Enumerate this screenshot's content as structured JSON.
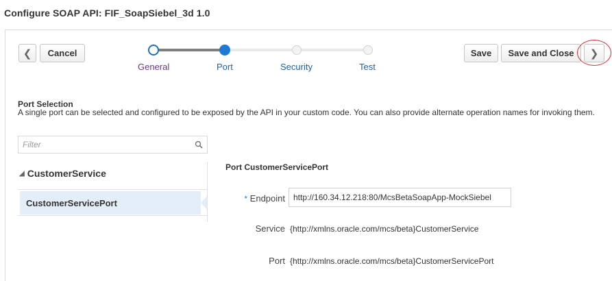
{
  "page": {
    "title": "Configure SOAP API: FIF_SoapSiebel_3d 1.0"
  },
  "toolbar": {
    "back_icon": "chevron-left-icon",
    "cancel_label": "Cancel",
    "save_label": "Save",
    "save_close_label": "Save and Close",
    "next_icon": "chevron-right-icon"
  },
  "train": {
    "steps": [
      {
        "label": "General",
        "state": "visited"
      },
      {
        "label": "Port",
        "state": "current"
      },
      {
        "label": "Security",
        "state": "unvisited"
      },
      {
        "label": "Test",
        "state": "unvisited"
      }
    ]
  },
  "section": {
    "title": "Port Selection",
    "description": "A single port can be selected and configured to be exposed by the API in your custom code. You can also provide alternate operation names for invoking them."
  },
  "filter": {
    "placeholder": "Filter",
    "icon": "search-icon"
  },
  "tree": {
    "group_label": "CustomerService",
    "items": [
      {
        "label": "CustomerServicePort",
        "selected": true
      }
    ]
  },
  "detail": {
    "title": "Port CustomerServicePort",
    "endpoint_label": "Endpoint",
    "endpoint_value": "http://160.34.12.218:80/McsBetaSoapApp-MockSiebel",
    "service_label": "Service",
    "service_value": "{http://xmlns.oracle.com/mcs/beta}CustomerService",
    "port_label": "Port",
    "port_value": "{http://xmlns.oracle.com/mcs/beta}CustomerServicePort"
  },
  "colors": {
    "accent": "#1f7ad3",
    "selection": "#e4eef8",
    "highlight_ring": "#d42a2a"
  }
}
